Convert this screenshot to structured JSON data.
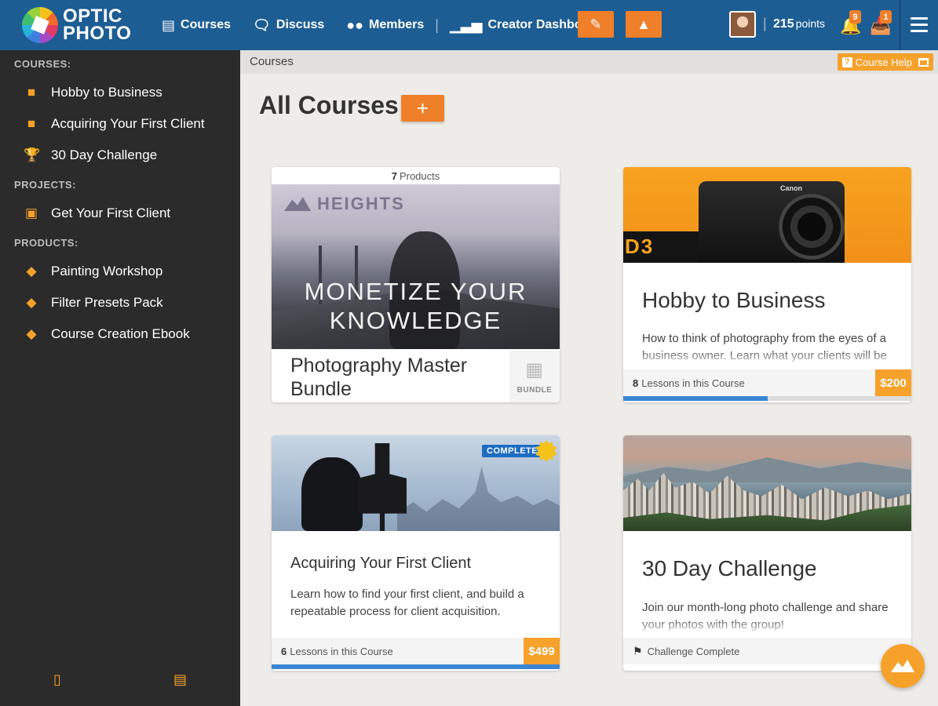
{
  "brand": {
    "line1": "OPTIC",
    "line2": "PHOTO"
  },
  "nav": [
    {
      "label": "Courses",
      "icon": "book-icon"
    },
    {
      "label": "Discuss",
      "icon": "chat-bubbles-icon"
    },
    {
      "label": "Members",
      "icon": "people-icon"
    },
    {
      "label": "Creator Dashboard",
      "icon": "bar-chart-icon"
    }
  ],
  "user": {
    "points_value": "215",
    "points_label": "points",
    "notifications_count": "9",
    "inbox_count": "1"
  },
  "sidebar": {
    "courses_heading": "COURSES:",
    "courses": [
      {
        "label": "Hobby to Business",
        "icon": "folder-icon"
      },
      {
        "label": "Acquiring Your First Client",
        "icon": "folder-icon"
      },
      {
        "label": "30 Day Challenge",
        "icon": "trophy-icon"
      }
    ],
    "projects_heading": "PROJECTS:",
    "projects": [
      {
        "label": "Get Your First Client",
        "icon": "briefcase-icon"
      }
    ],
    "products_heading": "PRODUCTS:",
    "products": [
      {
        "label": "Painting Workshop",
        "icon": "box-icon"
      },
      {
        "label": "Filter Presets Pack",
        "icon": "box-icon"
      },
      {
        "label": "Course Creation Ebook",
        "icon": "box-icon"
      }
    ]
  },
  "breadcrumb": "Courses",
  "help_label": "Course Help",
  "page": {
    "title": "All Courses",
    "add_symbol": "+"
  },
  "cards": [
    {
      "products_count": "7",
      "products_label": "Products",
      "image_brand": "HEIGHTS",
      "image_headline_1": "MONETIZE YOUR",
      "image_headline_2": "KNOWLEDGE",
      "title": "Photography Master Bundle",
      "tag": "BUNDLE"
    },
    {
      "camera_brand": "Canon",
      "strap_text": "D3",
      "title": "Hobby to Business",
      "description": "How to think of photography from the eyes of a business owner. Learn what your clients will be",
      "lessons_count": "8",
      "lessons_label": "Lessons in this Course",
      "price": "$200",
      "progress": 0.5
    },
    {
      "badge": "COMPLETE",
      "title": "Acquiring Your First Client",
      "description": "Learn how to find your first client, and build a repeatable process for client acquisition.",
      "lessons_count": "6",
      "lessons_label": "Lessons in this Course",
      "price": "$499",
      "progress": 1.0
    },
    {
      "title": "30 Day Challenge",
      "description": "Join our month-long photo challenge and share your photos with the group!",
      "status": "Challenge Complete"
    }
  ],
  "colors": {
    "topbar": "#1c5d94",
    "accent": "#f07f2a",
    "sidebar": "#2b2b2b",
    "progress": "#3a86d4"
  }
}
